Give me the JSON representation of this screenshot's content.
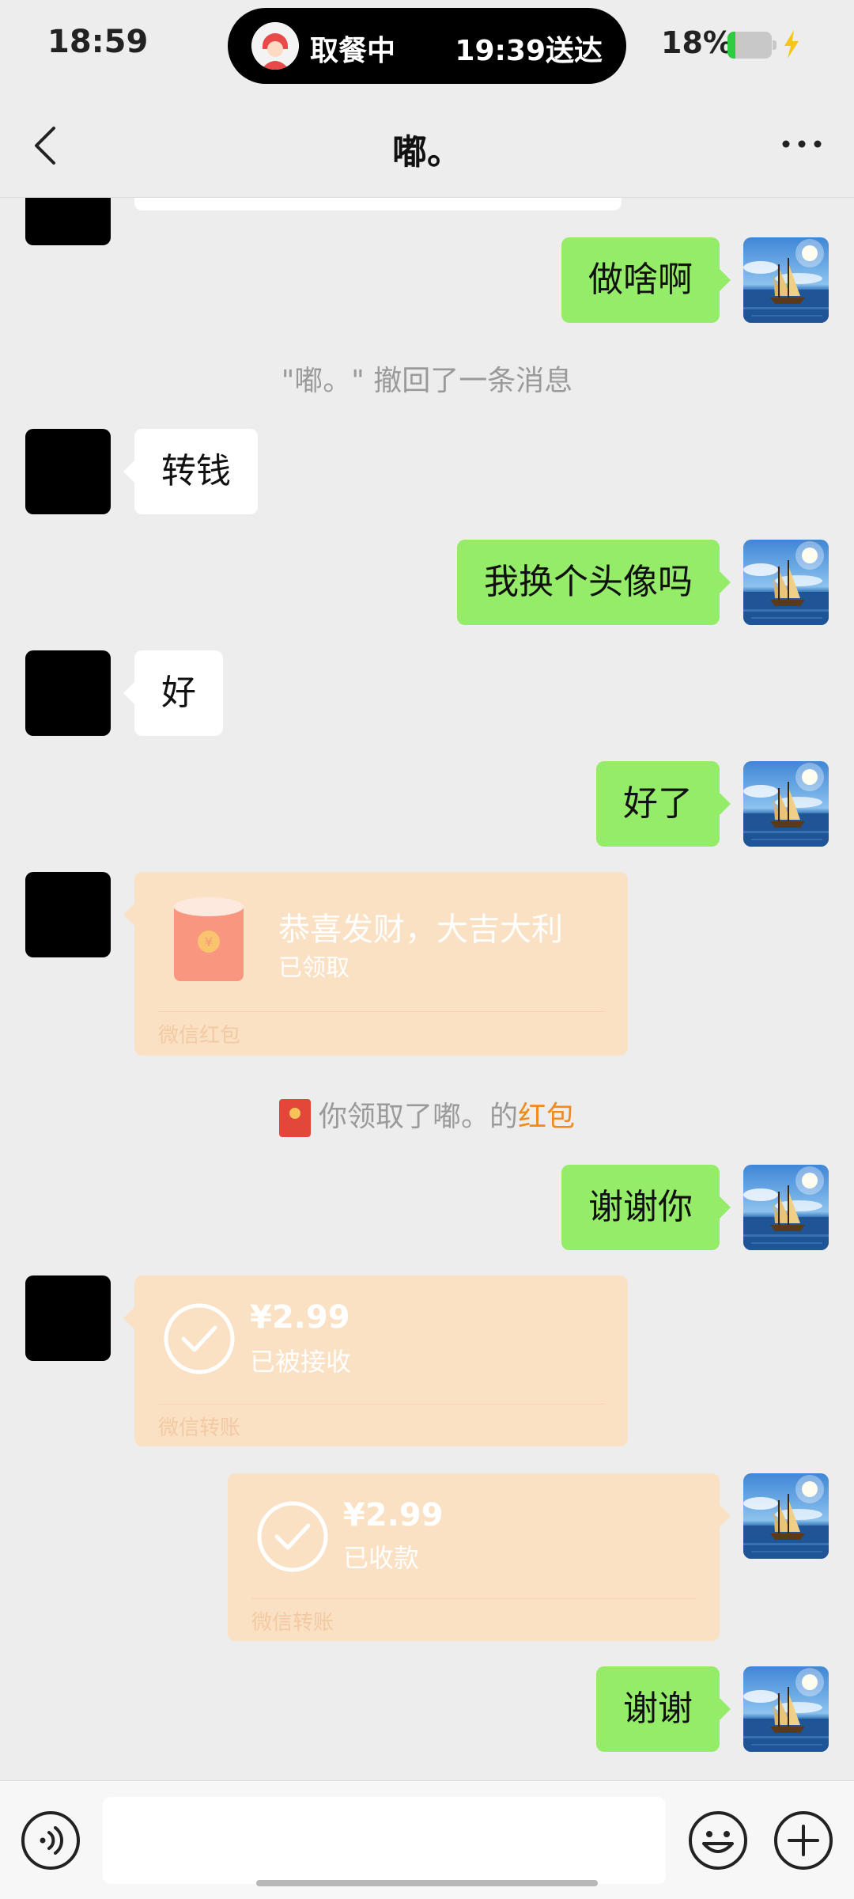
{
  "status_bar": {
    "time": "18:59",
    "island": {
      "status": "取餐中",
      "eta": "19:39送达"
    },
    "battery_percent": "18%",
    "battery_level": 0.18,
    "battery_color": "#2ecc40"
  },
  "header": {
    "title": "嘟。",
    "back_icon": "chevron-left-icon",
    "more_icon": "more-dots-icon"
  },
  "messages": {
    "m1": "做啥啊",
    "recall": "\"嘟。\" 撤回了一条消息",
    "m2": "转钱",
    "m3": "我换个头像吗",
    "m4": "好",
    "m5": "好了",
    "red_packet": {
      "wish": "恭喜发财，大吉大利",
      "status": "已领取",
      "footer": "微信红包"
    },
    "red_packet_notice": {
      "prefix": "你领取了嘟。的",
      "link": "红包"
    },
    "m6": "谢谢你",
    "transfer_received": {
      "amount": "¥2.99",
      "status": "已被接收",
      "footer": "微信转账"
    },
    "transfer_collected": {
      "amount": "¥2.99",
      "status": "已收款",
      "footer": "微信转账"
    },
    "m7": "谢谢"
  },
  "input_bar": {
    "voice_icon": "voice-icon",
    "emoji_icon": "emoji-icon",
    "plus_icon": "plus-icon",
    "placeholder": ""
  },
  "colors": {
    "my_bubble": "#95ec69",
    "their_bubble": "#ffffff",
    "card": "#fbe1c4",
    "link": "#f08a1a"
  }
}
